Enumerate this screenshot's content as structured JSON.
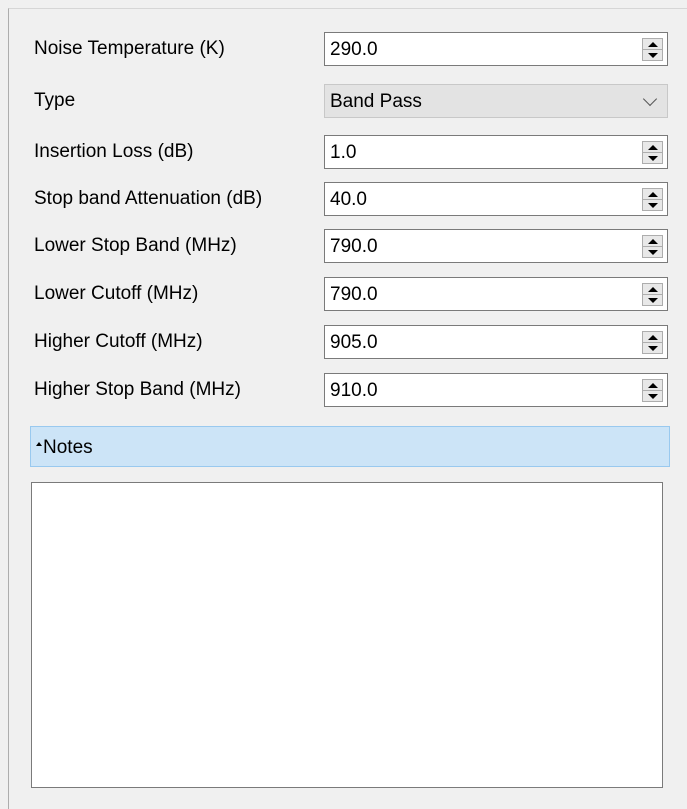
{
  "form": {
    "fields": [
      {
        "label": "Noise Temperature (K)",
        "value": "290.0",
        "kind": "spinner"
      },
      {
        "label": "Type",
        "value": "Band Pass",
        "kind": "combo"
      },
      {
        "label": "Insertion Loss (dB)",
        "value": "1.0",
        "kind": "spinner"
      },
      {
        "label": "Stop band Attenuation (dB)",
        "value": "40.0",
        "kind": "spinner"
      },
      {
        "label": "Lower Stop Band (MHz)",
        "value": "790.0",
        "kind": "spinner"
      },
      {
        "label": "Lower Cutoff (MHz)",
        "value": "790.0",
        "kind": "spinner"
      },
      {
        "label": "Higher Cutoff (MHz)",
        "value": "905.0",
        "kind": "spinner"
      },
      {
        "label": "Higher Stop Band (MHz)",
        "value": "910.0",
        "kind": "spinner"
      }
    ]
  },
  "notes": {
    "header_label": "Notes",
    "text": ""
  },
  "icons": {
    "spinner_up": "chevron-up-icon",
    "spinner_down": "chevron-down-icon",
    "combo_arrow": "chevron-down-icon",
    "notes_toggle": "collapse-caret-icon"
  },
  "colors": {
    "background": "#f0f0f0",
    "notes_header_bg": "#cce4f7",
    "notes_header_border": "#99c9ef",
    "field_border": "#7a7a7a",
    "combo_bg": "#e3e3e3"
  }
}
